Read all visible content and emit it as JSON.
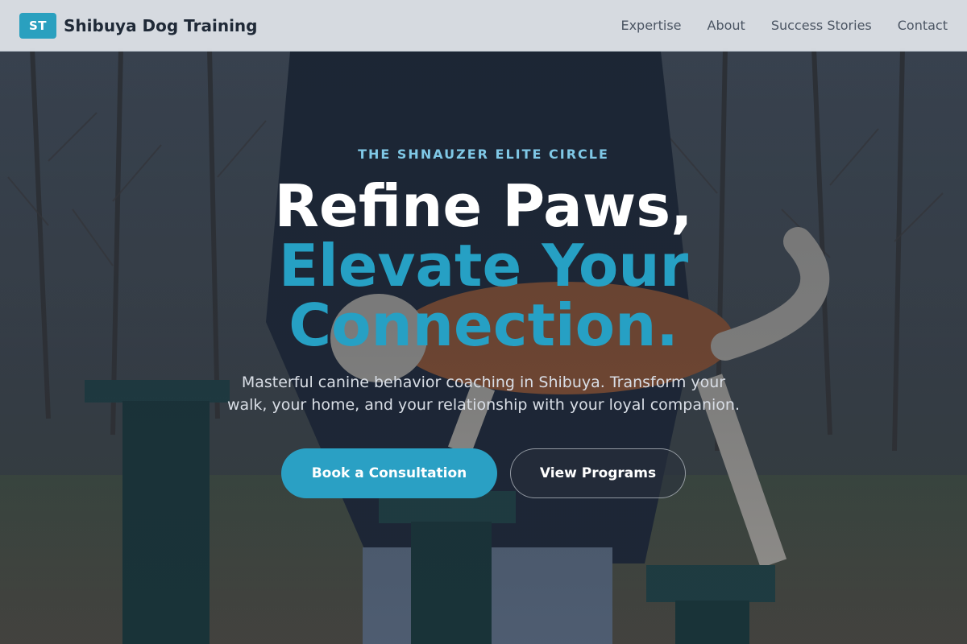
{
  "brand": {
    "logo_text": "ST",
    "name": "Shibuya Dog Training"
  },
  "nav": {
    "items": [
      "Expertise",
      "About",
      "Success Stories",
      "Contact"
    ]
  },
  "hero": {
    "eyebrow": "THE SHNAUZER ELITE CIRCLE",
    "headline_line1": "Refine Paws,",
    "headline_line2": "Elevate Your",
    "headline_line3": "Connection.",
    "subtitle_line1": "Masterful canine behavior coaching in Shibuya. Transform your",
    "subtitle_line2": "walk, your home, and your relationship with your loyal companion.",
    "primary_cta": "Book a Consultation",
    "secondary_cta": "View Programs"
  },
  "colors": {
    "accent": "#2aa0c4",
    "eyebrow": "#7fc8e6",
    "header_bg": "#e2e6ec",
    "text_dark": "#1f2937"
  },
  "background": {
    "scene": "person-with-dog-on-training-bench-in-forest"
  }
}
